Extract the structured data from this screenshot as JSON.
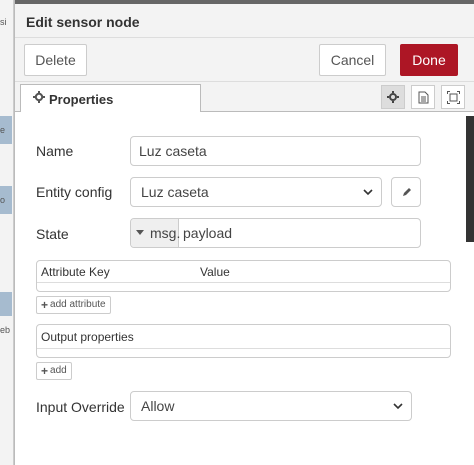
{
  "background": {
    "fragments": [
      "si",
      "e",
      "o",
      "",
      "eb"
    ]
  },
  "tray": {
    "title": "Edit sensor node",
    "toolbar": {
      "delete_label": "Delete",
      "cancel_label": "Cancel",
      "done_label": "Done"
    },
    "tabs": {
      "properties_label": "Properties",
      "icons": [
        "gear-icon",
        "description-icon",
        "appearance-icon"
      ]
    }
  },
  "form": {
    "name": {
      "label": "Name",
      "value": "Luz caseta"
    },
    "entity_config": {
      "label": "Entity config",
      "value": "Luz caseta"
    },
    "state": {
      "label": "State",
      "type": "msg.",
      "value": "payload"
    },
    "attributes": {
      "headers": [
        "Attribute Key",
        "Value"
      ],
      "add_label": "add attribute"
    },
    "output_properties": {
      "header": "Output properties",
      "add_label": "add"
    },
    "input_override": {
      "label": "Input Override",
      "value": "Allow"
    }
  },
  "colors": {
    "done": "#ad1625",
    "background_node": "#a6bbcf"
  }
}
